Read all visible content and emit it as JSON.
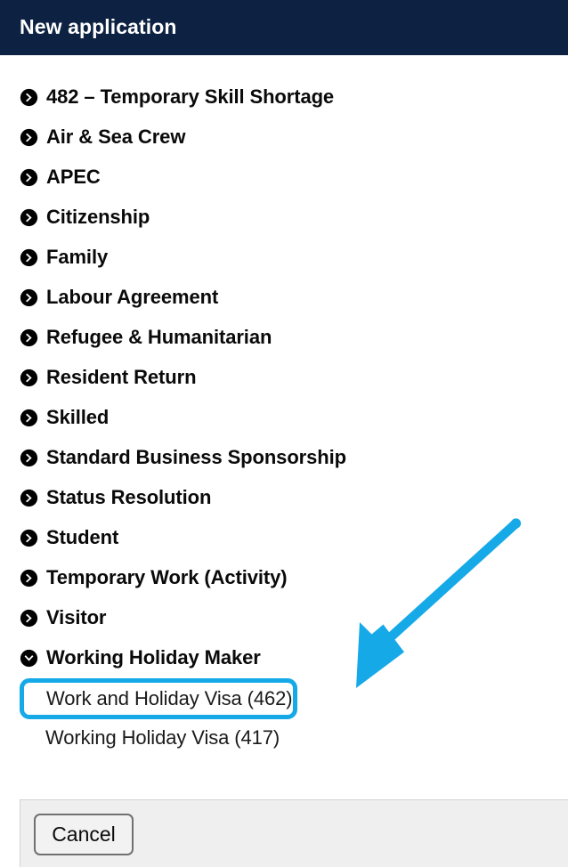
{
  "header": {
    "title": "New application"
  },
  "categories": [
    {
      "label": "482 – Temporary Skill Shortage",
      "icon": "chevron-right-circle-icon",
      "expanded": false
    },
    {
      "label": "Air & Sea Crew",
      "icon": "chevron-right-circle-icon",
      "expanded": false
    },
    {
      "label": "APEC",
      "icon": "chevron-right-circle-icon",
      "expanded": false
    },
    {
      "label": "Citizenship",
      "icon": "chevron-right-circle-icon",
      "expanded": false
    },
    {
      "label": "Family",
      "icon": "chevron-right-circle-icon",
      "expanded": false
    },
    {
      "label": "Labour Agreement",
      "icon": "chevron-right-circle-icon",
      "expanded": false
    },
    {
      "label": "Refugee & Humanitarian",
      "icon": "chevron-right-circle-icon",
      "expanded": false
    },
    {
      "label": "Resident Return",
      "icon": "chevron-right-circle-icon",
      "expanded": false
    },
    {
      "label": "Skilled",
      "icon": "chevron-right-circle-icon",
      "expanded": false
    },
    {
      "label": "Standard Business Sponsorship",
      "icon": "chevron-right-circle-icon",
      "expanded": false
    },
    {
      "label": "Status Resolution",
      "icon": "chevron-right-circle-icon",
      "expanded": false
    },
    {
      "label": "Student",
      "icon": "chevron-right-circle-icon",
      "expanded": false
    },
    {
      "label": "Temporary Work (Activity)",
      "icon": "chevron-right-circle-icon",
      "expanded": false
    },
    {
      "label": "Visitor",
      "icon": "chevron-right-circle-icon",
      "expanded": false
    },
    {
      "label": "Working Holiday Maker",
      "icon": "chevron-down-circle-icon",
      "expanded": true
    }
  ],
  "subitems": [
    {
      "label": "Work and Holiday Visa (462)",
      "highlighted": true
    },
    {
      "label": "Working Holiday Visa (417)",
      "highlighted": false
    }
  ],
  "footer": {
    "cancel_label": "Cancel"
  },
  "annotation": {
    "type": "arrow",
    "points_to": "Work and Holiday Visa (462)",
    "color": "#16a9e8"
  },
  "colors": {
    "header_background": "#0d2243",
    "header_text": "#ffffff",
    "highlight": "#16a9e8",
    "page_background": "#ffffff",
    "footer_background": "#efefef",
    "list_text": "#0a0a0a"
  }
}
